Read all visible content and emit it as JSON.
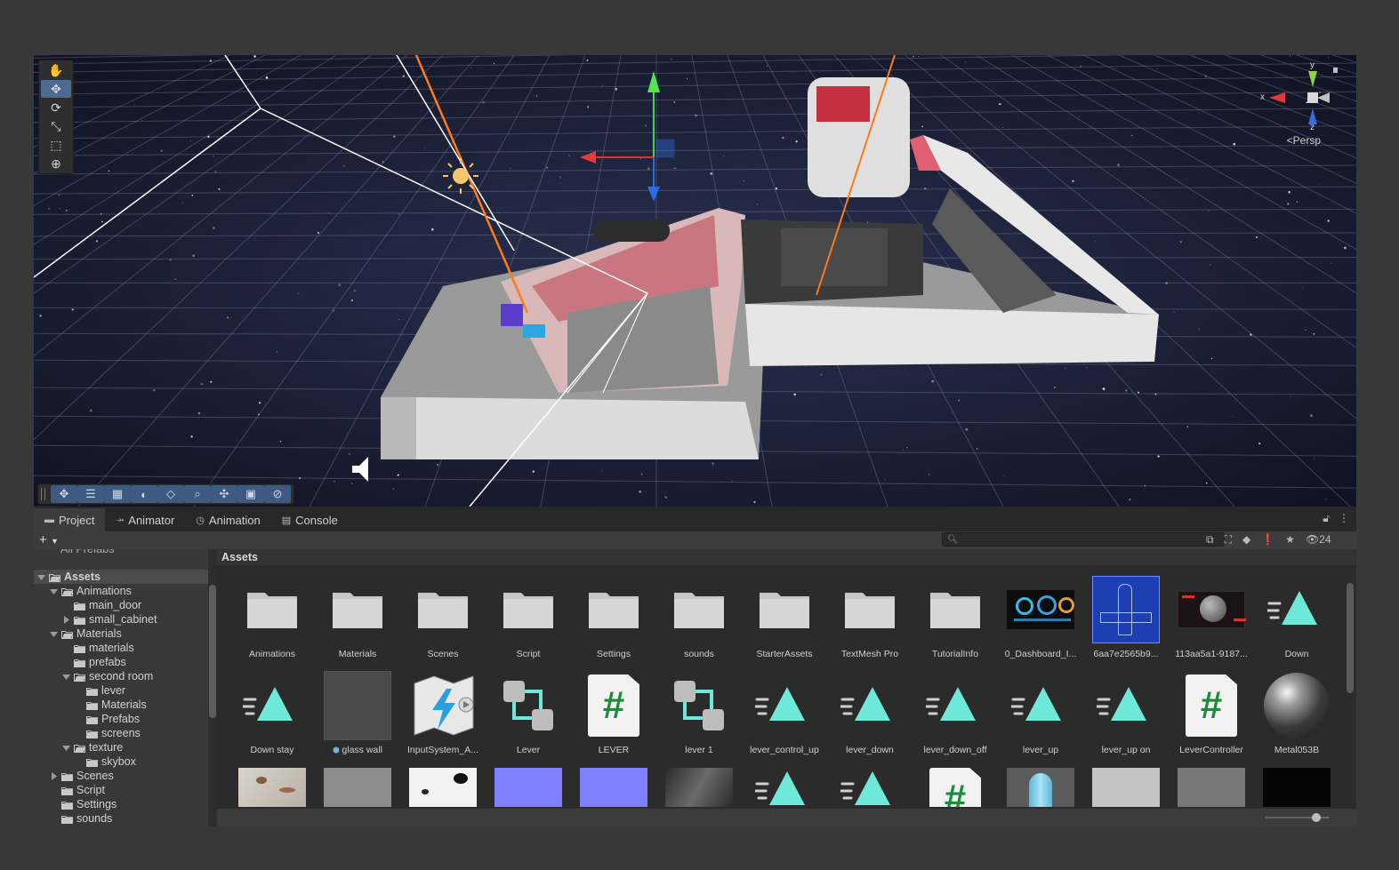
{
  "tabs": [
    {
      "label": "Project",
      "icon": "folder-icon",
      "active": true
    },
    {
      "label": "Animator",
      "icon": "animator-icon",
      "active": false
    },
    {
      "label": "Animation",
      "icon": "clock-icon",
      "active": false
    },
    {
      "label": "Console",
      "icon": "console-icon",
      "active": false
    }
  ],
  "scene": {
    "persp_label": "<Persp",
    "gizmo_axes": {
      "x": "x",
      "y": "y",
      "z": "z"
    },
    "tools": [
      "hand-tool-icon",
      "move-tool-icon",
      "rotate-tool-icon",
      "scale-tool-icon",
      "rect-tool-icon",
      "transform-tool-icon"
    ],
    "overlay_tools": [
      "move-icon",
      "settings-icon",
      "grid-icon",
      "shading-icon",
      "snap-icon",
      "search-icon",
      "pivot-icon",
      "camera-icon",
      "compass-icon"
    ]
  },
  "toolbar": {
    "add_label": "+",
    "hidden_count": "24",
    "search_placeholder": ""
  },
  "tree": {
    "partial_top": "All Prefabs",
    "items": [
      {
        "label": "Assets",
        "depth": 0,
        "expanded": true,
        "selected": true,
        "bold": true
      },
      {
        "label": "Animations",
        "depth": 1,
        "expanded": true
      },
      {
        "label": "main_door",
        "depth": 2,
        "leaf": true
      },
      {
        "label": "small_cabinet",
        "depth": 2,
        "expanded": false
      },
      {
        "label": "Materials",
        "depth": 1,
        "expanded": true
      },
      {
        "label": "materials",
        "depth": 2,
        "leaf": true
      },
      {
        "label": "prefabs",
        "depth": 2,
        "leaf": true
      },
      {
        "label": "second room",
        "depth": 2,
        "expanded": true
      },
      {
        "label": "lever",
        "depth": 3,
        "leaf": true
      },
      {
        "label": "Materials",
        "depth": 3,
        "leaf": true
      },
      {
        "label": "Prefabs",
        "depth": 3,
        "leaf": true
      },
      {
        "label": "screens",
        "depth": 3,
        "leaf": true
      },
      {
        "label": "texture",
        "depth": 2,
        "expanded": true
      },
      {
        "label": "skybox",
        "depth": 3,
        "leaf": true
      },
      {
        "label": "Scenes",
        "depth": 1,
        "expanded": false
      },
      {
        "label": "Script",
        "depth": 1,
        "leaf": true
      },
      {
        "label": "Settings",
        "depth": 1,
        "leaf": true
      },
      {
        "label": "sounds",
        "depth": 1,
        "leaf": true
      }
    ]
  },
  "assets": {
    "header": "Assets",
    "row1": [
      {
        "label": "Animations",
        "kind": "folder"
      },
      {
        "label": "Materials",
        "kind": "folder"
      },
      {
        "label": "Scenes",
        "kind": "folder"
      },
      {
        "label": "Script",
        "kind": "folder"
      },
      {
        "label": "Settings",
        "kind": "folder"
      },
      {
        "label": "sounds",
        "kind": "folder"
      },
      {
        "label": "StarterAssets",
        "kind": "folder"
      },
      {
        "label": "TextMesh Pro",
        "kind": "folder"
      },
      {
        "label": "TutorialInfo",
        "kind": "folder"
      },
      {
        "label": "0_Dashboard_I...",
        "kind": "dashboard"
      },
      {
        "label": "6aa7e2565b9...",
        "kind": "blueprint"
      },
      {
        "label": "113aa5a1-9187...",
        "kind": "planet"
      },
      {
        "label": "Down",
        "kind": "anim"
      }
    ],
    "row2": [
      {
        "label": "Down stay",
        "kind": "anim"
      },
      {
        "label": "glass wall",
        "kind": "grey",
        "prefix_icon": "prefab-cube-icon"
      },
      {
        "label": "InputSystem_A...",
        "kind": "inputsys"
      },
      {
        "label": "Lever",
        "kind": "controller"
      },
      {
        "label": "LEVER",
        "kind": "script"
      },
      {
        "label": "lever 1",
        "kind": "controller"
      },
      {
        "label": "lever_control_up",
        "kind": "anim"
      },
      {
        "label": "lever_down",
        "kind": "anim"
      },
      {
        "label": "lever_down_off",
        "kind": "anim"
      },
      {
        "label": "lever_up",
        "kind": "anim"
      },
      {
        "label": "lever_up on",
        "kind": "anim"
      },
      {
        "label": "LeverController",
        "kind": "script"
      },
      {
        "label": "Metal053B",
        "kind": "sphere"
      }
    ],
    "row3": [
      {
        "label": "",
        "kind": "rust"
      },
      {
        "label": "",
        "kind": "concrete"
      },
      {
        "label": "",
        "kind": "spots"
      },
      {
        "label": "",
        "kind": "normal"
      },
      {
        "label": "",
        "kind": "normal"
      },
      {
        "label": "",
        "kind": "darkrock"
      },
      {
        "label": "",
        "kind": "anim"
      },
      {
        "label": "",
        "kind": "anim"
      },
      {
        "label": "",
        "kind": "script"
      },
      {
        "label": "",
        "kind": "capsule"
      },
      {
        "label": "",
        "kind": "lightgrey"
      },
      {
        "label": "",
        "kind": "midgrey"
      },
      {
        "label": "",
        "kind": "black"
      }
    ]
  },
  "colors": {
    "accent_teal": "#6ee8d8",
    "selection_blue": "#4d6a93",
    "panel_bg": "#383838",
    "grid_bg": "#2b2b2b"
  }
}
